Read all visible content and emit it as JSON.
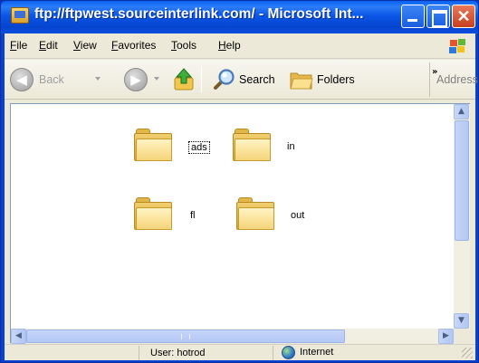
{
  "window": {
    "title": "ftp://ftpwest.sourceinterlink.com/ - Microsoft Int...",
    "close_glyph": "✕"
  },
  "menu": {
    "items": [
      "File",
      "Edit",
      "View",
      "Favorites",
      "Tools",
      "Help"
    ]
  },
  "toolbar": {
    "back_label": "Back",
    "back_glyph": "◀",
    "forward_glyph": "▶",
    "search_label": "Search",
    "folders_label": "Folders",
    "overflow_glyph": "»",
    "address_label": "Address"
  },
  "folders": [
    {
      "name": "ads",
      "selected": true
    },
    {
      "name": "in",
      "selected": false
    },
    {
      "name": "fl",
      "selected": false
    },
    {
      "name": "out",
      "selected": false
    }
  ],
  "scrollbars": {
    "up_glyph": "▲",
    "down_glyph": "▼",
    "left_glyph": "◀",
    "right_glyph": "▶"
  },
  "status": {
    "user_text": "User: hotrod",
    "zone_text": "Internet"
  },
  "colors": {
    "titlebar": "#0a56e6",
    "chrome": "#ece9d8",
    "content_bg": "#ffffff",
    "scrollbar_accent": "#b3c8f4"
  }
}
